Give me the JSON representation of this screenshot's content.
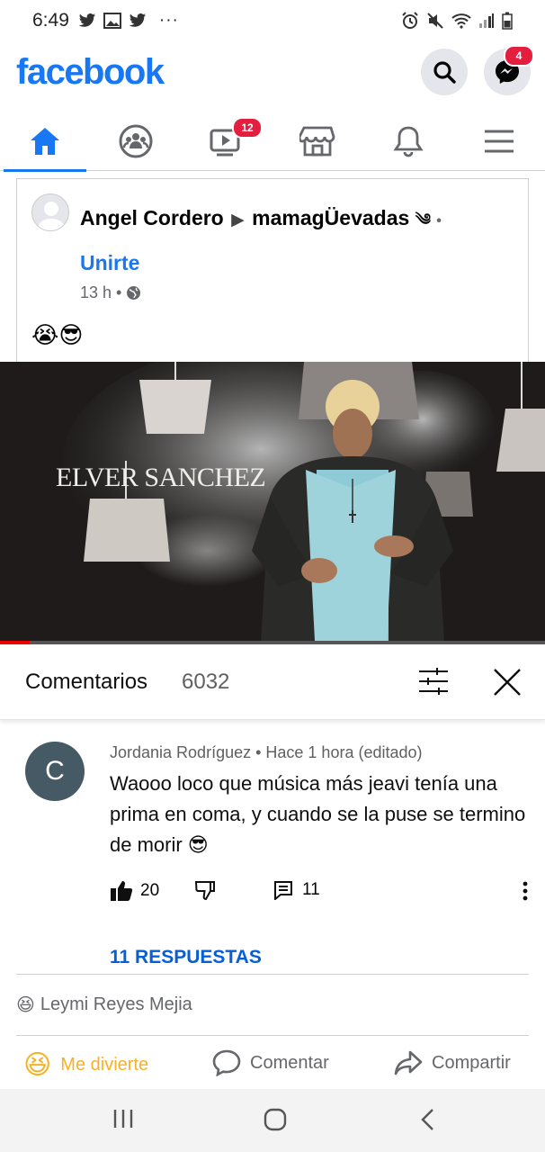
{
  "status_bar": {
    "time": "6:49",
    "left_icons": [
      "twitter-icon",
      "image-icon",
      "twitter-icon",
      "more-dots"
    ],
    "right_icons": [
      "alarm-icon",
      "mute-icon",
      "wifi-icon",
      "signal-icon",
      "battery-icon"
    ]
  },
  "header": {
    "logo": "facebook",
    "messenger_badge": "4"
  },
  "nav": {
    "tabs": [
      {
        "name": "home",
        "active": true
      },
      {
        "name": "groups"
      },
      {
        "name": "watch",
        "badge": "12"
      },
      {
        "name": "marketplace"
      },
      {
        "name": "notifications"
      },
      {
        "name": "menu"
      }
    ]
  },
  "post": {
    "author": "Angel Cordero",
    "arrow": "▶",
    "group": "mamagÜevadas",
    "group_emoji": "༄",
    "dot": "•",
    "join_label": "Unirte",
    "time": "13 h",
    "separator": "•",
    "emojis": "😭😎"
  },
  "video": {
    "overlay_text": "ELVER SANCHEZ",
    "progress_fraction": 0.055
  },
  "comments": {
    "title": "Comentarios",
    "count": "6032",
    "item": {
      "avatar_letter": "C",
      "author_line": "Jordania Rodríguez • Hace 1 hora (editado)",
      "text": "Waooo loco que música más jeavi tenía una prima en coma, y cuando se la puse se termino de morir 😎",
      "likes": "20",
      "reply_count": "11",
      "replies_label": "11 RESPUESTAS"
    }
  },
  "reactions": {
    "emoji": "😆",
    "names": "Leymi Reyes Mejia"
  },
  "actions": {
    "react_label": "Me divierte",
    "react_emoji": "😆",
    "comment_label": "Comentar",
    "share_label": "Compartir"
  },
  "colors": {
    "brand": "#1877f2",
    "badge": "#e41e3f",
    "link_blue": "#065fd4",
    "reaction_yellow": "#f7b125"
  }
}
